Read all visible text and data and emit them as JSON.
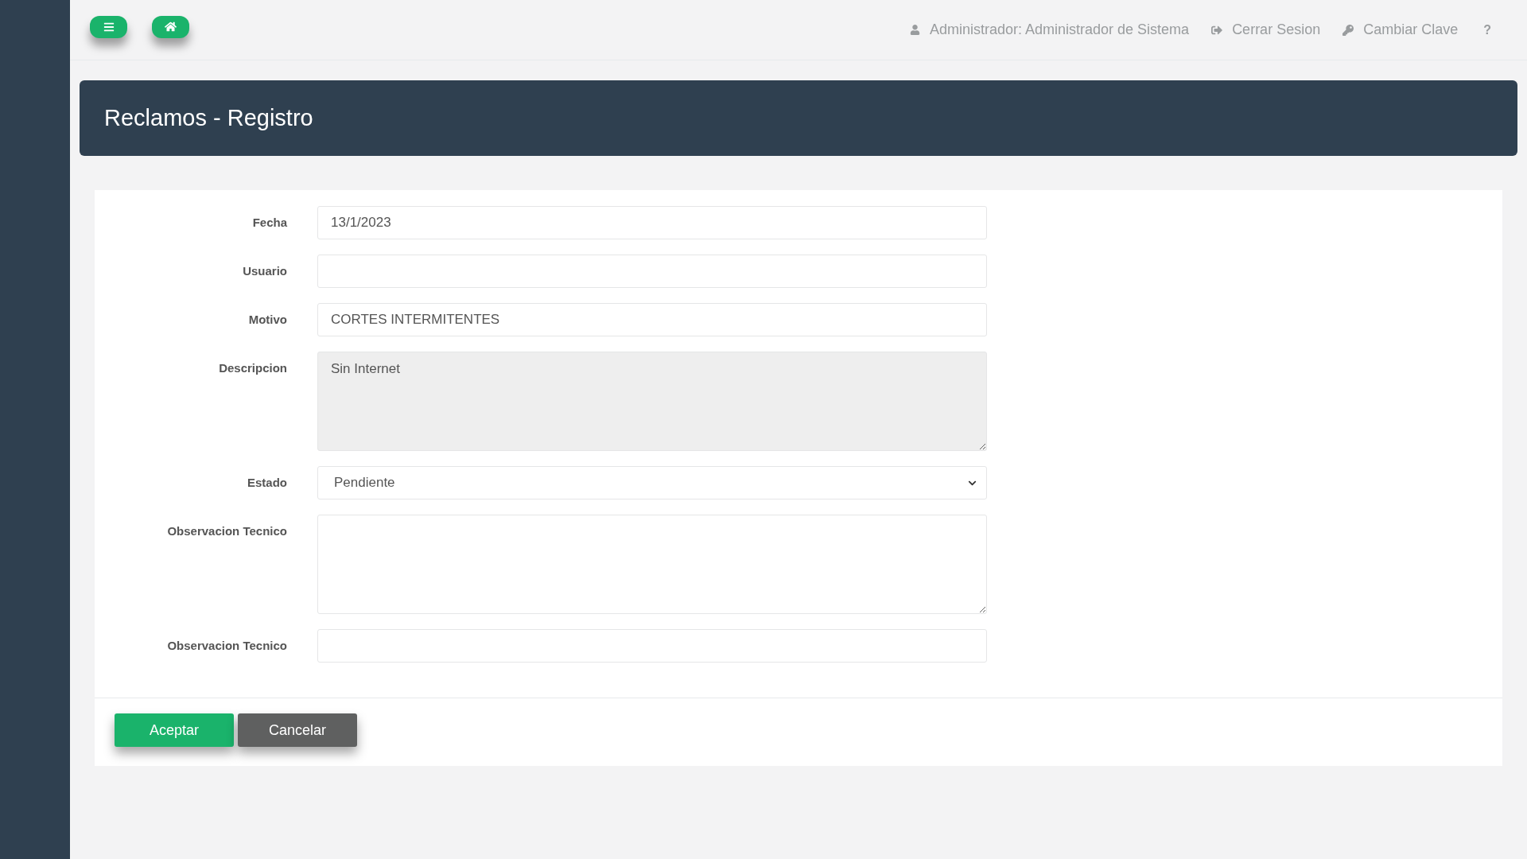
{
  "topbar": {
    "user": "Administrador: Administrador de Sistema",
    "links": [
      {
        "kind": "logout",
        "label": "Cerrar Sesion"
      },
      {
        "kind": "key",
        "label": "Cambiar Clave"
      },
      {
        "kind": "help",
        "label": "?"
      }
    ]
  },
  "page_title": "Reclamos - Registro",
  "form": {
    "fields": [
      {
        "kind": "text",
        "label": "Fecha",
        "value": "13/1/2023",
        "disabled": false
      },
      {
        "kind": "text",
        "label": "Usuario",
        "disabled": false
      },
      {
        "kind": "textarea_short",
        "label": "Motivo",
        "value": "CORTES INTERMITENTES",
        "disabled": false
      },
      {
        "kind": "textarea",
        "label": "Descripcion",
        "value": "Sin Internet",
        "disabled": true
      },
      {
        "kind": "select",
        "label": "Estado",
        "value": "Pendiente",
        "disabled": false
      },
      {
        "kind": "textarea",
        "label": "Observacion Tecnico",
        "disabled": false
      },
      {
        "kind": "text",
        "label": "Observacion Tecnico",
        "disabled": false
      }
    ]
  },
  "buttons": [
    {
      "kind": "primary",
      "label": "Aceptar"
    },
    {
      "kind": "secondary",
      "label": "Cancelar"
    }
  ]
}
